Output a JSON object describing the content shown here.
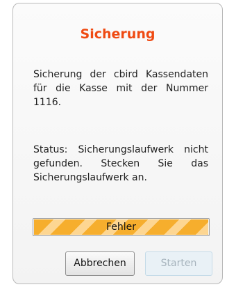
{
  "dialog": {
    "title": "Sicherung",
    "description": "Sicherung der cbird Kassendaten für die Kasse mit der Nummer 1116.",
    "status_text": "Status: Sicherungslaufwerk nicht gefunden. Stecken Sie das Sicherungslaufwerk an."
  },
  "progress": {
    "label": "Fehler",
    "value_percent": 100,
    "state": "error"
  },
  "buttons": {
    "cancel_label": "Abbrechen",
    "start_label": "Starten",
    "start_enabled": false
  },
  "colors": {
    "title": "#ef4a12",
    "progress_stripe_dark": "#f6ae2d",
    "progress_stripe_light": "#fdd692",
    "disabled_button_bg": "#e9f1f6"
  }
}
